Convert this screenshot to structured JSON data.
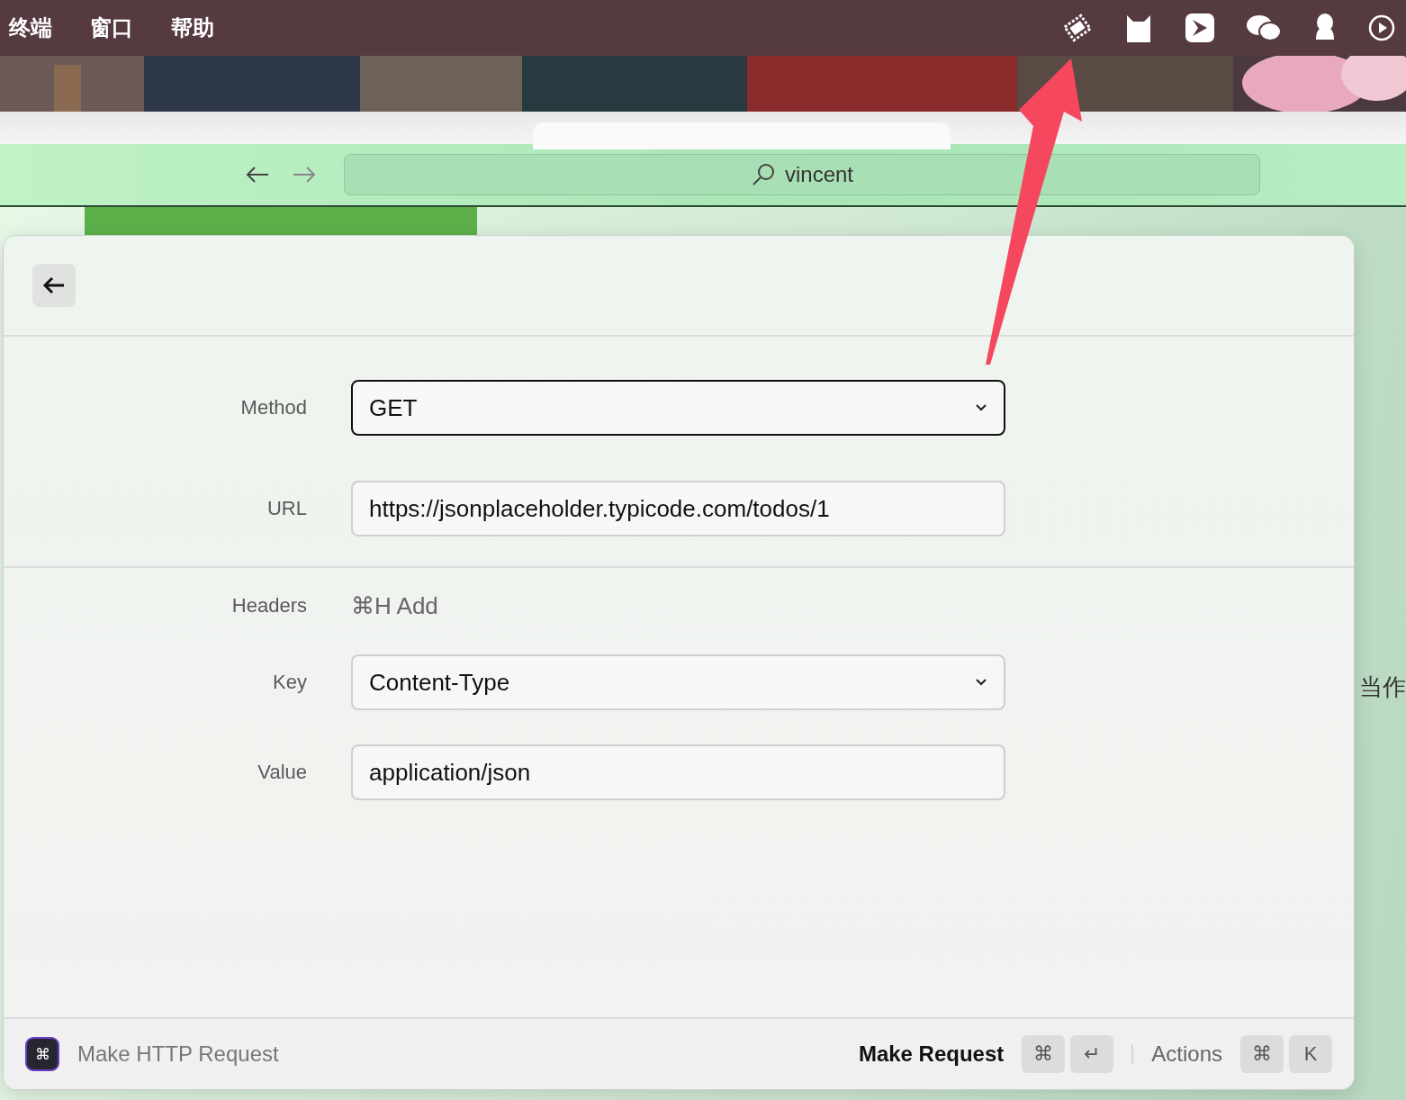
{
  "menu_bar": {
    "items": [
      "终端",
      "窗口",
      "帮助"
    ]
  },
  "browser": {
    "address": "vincent"
  },
  "background_text": "当作",
  "panel": {
    "fields": [
      {
        "label": "Method",
        "kind": "select",
        "value": "GET",
        "focused": true
      },
      {
        "label": "URL",
        "kind": "text",
        "value": "https://jsonplaceholder.typicode.com/todos/1",
        "focused": false
      }
    ],
    "headers": {
      "label": "Headers",
      "shortcut": "⌘H Add"
    },
    "header_fields": [
      {
        "label": "Key",
        "kind": "select",
        "value": "Content-Type",
        "focused": false
      },
      {
        "label": "Value",
        "kind": "text",
        "value": "application/json",
        "focused": false
      }
    ]
  },
  "footer": {
    "app_icon": "⌘",
    "title": "Make HTTP Request",
    "primary_action": "Make Request",
    "primary_keys": [
      "⌘",
      "↵"
    ],
    "secondary_action": "Actions",
    "secondary_keys": [
      "⌘",
      "K"
    ]
  }
}
